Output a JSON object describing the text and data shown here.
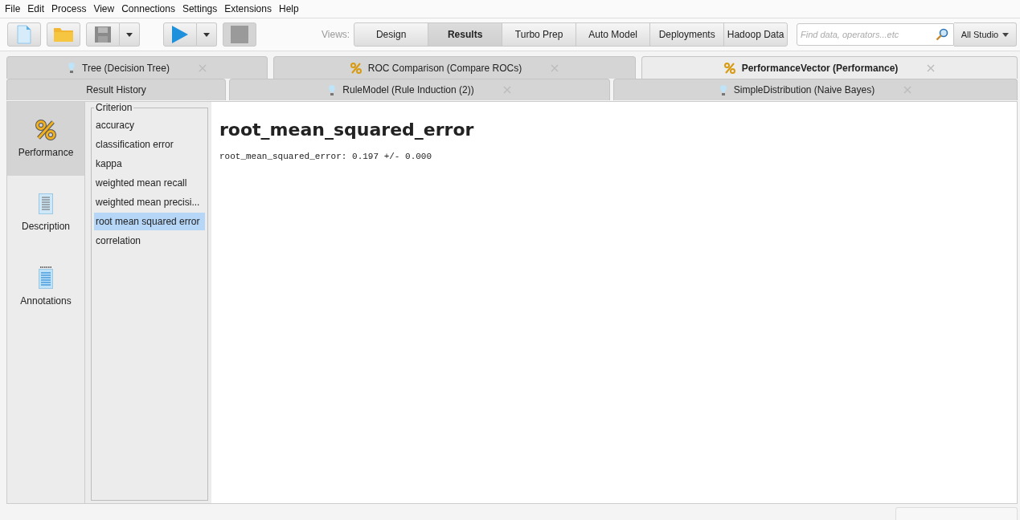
{
  "menu": [
    "File",
    "Edit",
    "Process",
    "View",
    "Connections",
    "Settings",
    "Extensions",
    "Help"
  ],
  "views_label": "Views:",
  "views": [
    {
      "label": "Design",
      "selected": false
    },
    {
      "label": "Results",
      "selected": true
    },
    {
      "label": "Turbo Prep",
      "selected": false
    },
    {
      "label": "Auto Model",
      "selected": false
    },
    {
      "label": "Deployments",
      "selected": false
    },
    {
      "label": "Hadoop Data",
      "selected": false
    }
  ],
  "search": {
    "placeholder": "Find data, operators...etc"
  },
  "scope": "All Studio",
  "tab_rows": [
    [
      {
        "label": "Tree (Decision Tree)",
        "kind": "model",
        "closable": true,
        "selected": false
      },
      {
        "label": "ROC Comparison (Compare ROCs)",
        "kind": "performance",
        "closable": true,
        "selected": false
      },
      {
        "label": "PerformanceVector (Performance)",
        "kind": "performance",
        "closable": true,
        "selected": true
      }
    ],
    [
      {
        "label": "Result History",
        "kind": "history",
        "closable": false,
        "selected": false
      },
      {
        "label": "RuleModel (Rule Induction (2))",
        "kind": "model",
        "closable": true,
        "selected": false
      },
      {
        "label": "SimpleDistribution (Naive Bayes)",
        "kind": "model",
        "closable": true,
        "selected": false
      }
    ]
  ],
  "sidebar": [
    {
      "label": "Performance",
      "kind": "performance",
      "selected": true
    },
    {
      "label": "Description",
      "kind": "description",
      "selected": false
    },
    {
      "label": "Annotations",
      "kind": "annotations",
      "selected": false
    }
  ],
  "criterion": {
    "title": "Criterion",
    "items": [
      {
        "label": "accuracy",
        "selected": false
      },
      {
        "label": "classification error",
        "selected": false
      },
      {
        "label": "kappa",
        "selected": false
      },
      {
        "label": "weighted mean recall",
        "selected": false
      },
      {
        "label": "weighted mean precisi...",
        "selected": false
      },
      {
        "label": "root mean squared error",
        "selected": true
      },
      {
        "label": "correlation",
        "selected": false
      }
    ]
  },
  "result": {
    "heading": "root_mean_squared_error",
    "text": "root_mean_squared_error: 0.197 +/- 0.000"
  }
}
